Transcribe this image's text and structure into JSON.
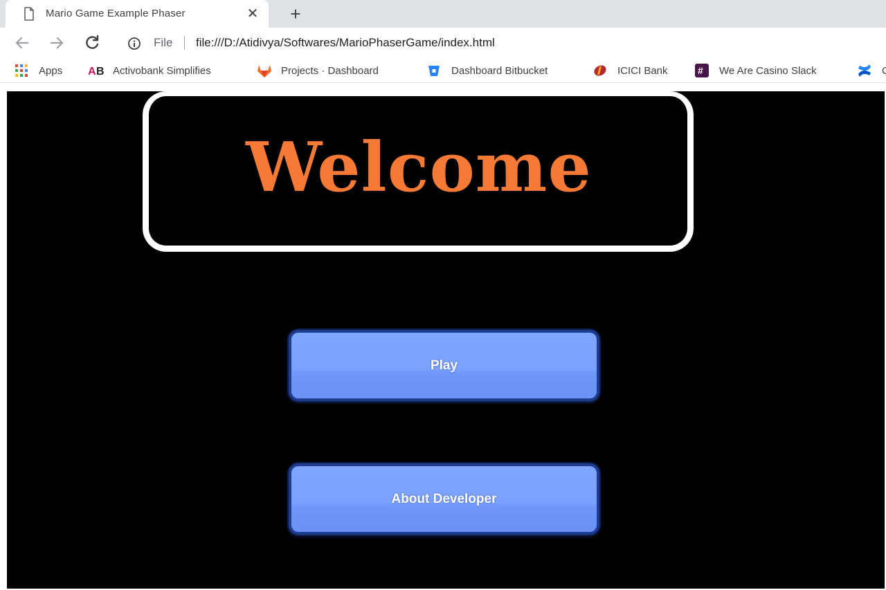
{
  "browser": {
    "tab": {
      "title": "Mario Game Example Phaser",
      "icon": "document-icon",
      "close_glyph": "✕"
    },
    "new_tab_glyph": "+",
    "toolbar": {
      "back_icon": "arrow-left-icon",
      "forward_icon": "arrow-right-icon",
      "reload_icon": "reload-icon",
      "site_info_icon": "info-icon",
      "scheme_chip": "File",
      "url": "file:///D:/Atidivya/Softwares/MarioPhaserGame/index.html"
    },
    "bookmarks": [
      {
        "label": "Apps",
        "icon": "apps-grid-icon"
      },
      {
        "label": "Activobank Simplifies",
        "icon": "activobank-icon"
      },
      {
        "label": "Projects · Dashboard",
        "icon": "gitlab-icon"
      },
      {
        "label": "Dashboard Bitbucket",
        "icon": "bitbucket-icon"
      },
      {
        "label": "ICICI Bank",
        "icon": "icici-icon"
      },
      {
        "label": "We Are Casino Slack",
        "icon": "slack-hash-icon"
      },
      {
        "label": "C",
        "icon": "confluence-icon"
      }
    ]
  },
  "game": {
    "welcome_text": "Welcome",
    "buttons": {
      "play": "Play",
      "about": "About Developer"
    }
  },
  "colors": {
    "welcome_text": "#f47a36",
    "button_fill": "#7ba2ff",
    "button_border": "#1e3d8f",
    "canvas_bg": "#000000"
  }
}
